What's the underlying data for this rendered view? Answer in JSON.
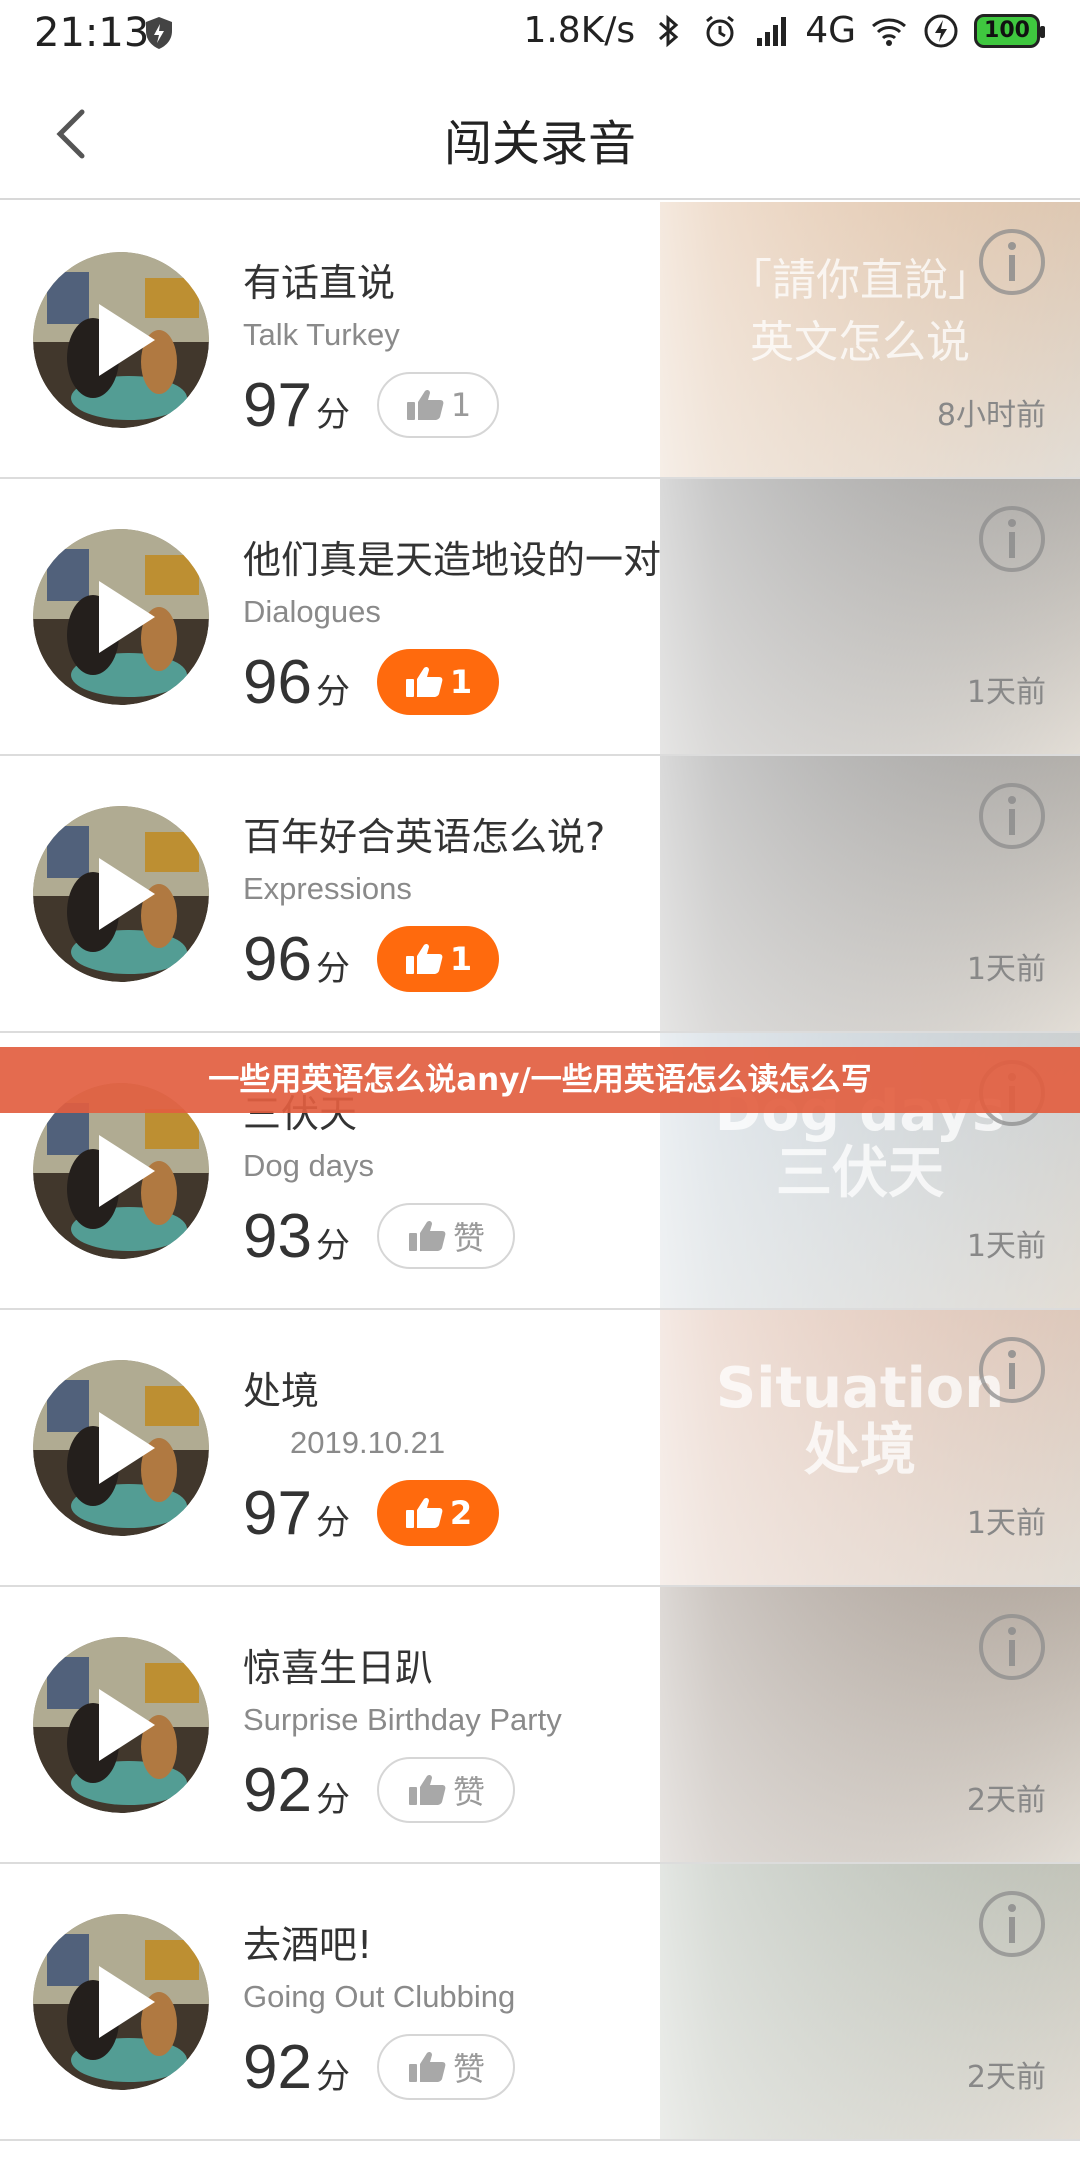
{
  "status_bar": {
    "time": "21:13",
    "network_speed": "1.8K/s",
    "network": "4G",
    "battery": "100",
    "icons": [
      "shield-icon",
      "bluetooth-icon",
      "alarm-icon",
      "signal-icon",
      "wifi-icon",
      "charging-icon",
      "battery-icon"
    ]
  },
  "header": {
    "title": "闯关录音",
    "back_icon": "chevron-left-icon"
  },
  "banner": {
    "text": "一些用英语怎么说any/一些用英语怎么读怎么写"
  },
  "score_unit": "分",
  "colors": {
    "accent": "#ff6a0d",
    "banner": "#e25e40"
  },
  "rows": [
    {
      "title": "有话直说",
      "subtitle": "Talk Turkey",
      "score": "97",
      "likes": "1",
      "liked": false,
      "time": "8小时前",
      "bg_text": [
        "「請你直說」",
        "英文怎么说"
      ],
      "bg_big": false,
      "bg_color": "#c98a52"
    },
    {
      "title": "他们真是天造地设的一对",
      "subtitle": "Dialogues",
      "score": "96",
      "likes": "1",
      "liked": true,
      "time": "1天前",
      "bg_text": [],
      "bg_big": false,
      "bg_color": "#3a3a3a"
    },
    {
      "title": "百年好合英语怎么说?",
      "subtitle": "Expressions",
      "score": "96",
      "likes": "1",
      "liked": true,
      "time": "1天前",
      "bg_text": [],
      "bg_big": false,
      "bg_color": "#3a3a3a"
    },
    {
      "title": "三伏天",
      "subtitle": "Dog days",
      "score": "93",
      "likes": "赞",
      "liked": false,
      "time": "1天前",
      "bg_text": [
        "Dog days",
        "三伏天"
      ],
      "bg_big": true,
      "bg_color": "#8fa6b8"
    },
    {
      "title": "处境",
      "subtitle": "2019.10.21",
      "score": "97",
      "likes": "2",
      "liked": true,
      "time": "1天前",
      "bg_text": [
        "Situation",
        "处境"
      ],
      "bg_big": true,
      "bg_color": "#c88d70",
      "subtitle_is_date": true
    },
    {
      "title": "惊喜生日趴",
      "subtitle": "Surprise Birthday Party",
      "score": "92",
      "likes": "赞",
      "liked": false,
      "time": "2天前",
      "bg_text": [],
      "bg_big": false,
      "bg_color": "#4b3524"
    },
    {
      "title": "去酒吧!",
      "subtitle": "Going Out Clubbing",
      "score": "92",
      "likes": "赞",
      "liked": false,
      "time": "2天前",
      "bg_text": [],
      "bg_big": false,
      "bg_color": "#6d7d6a"
    }
  ]
}
